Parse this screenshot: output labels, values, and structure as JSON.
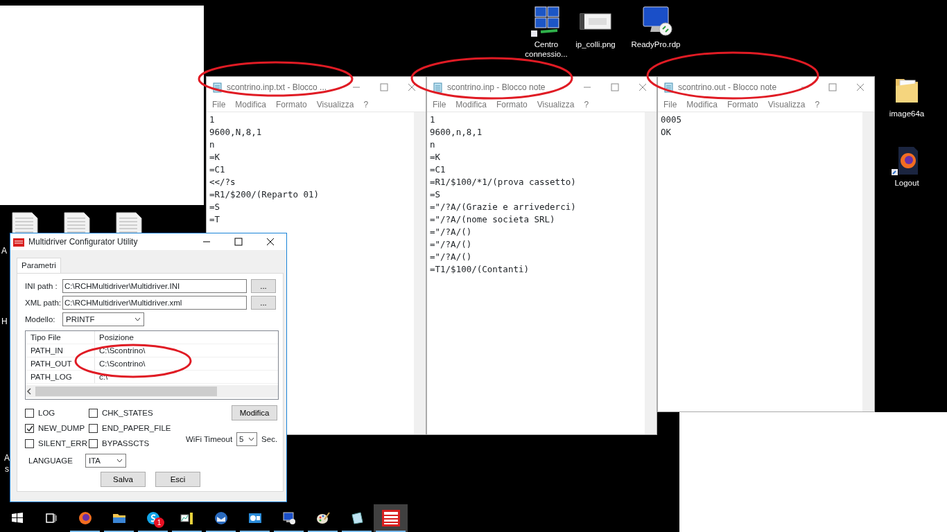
{
  "desktop_icons": [
    {
      "kind": "monitors",
      "label": "Centro connessio..."
    },
    {
      "kind": "image",
      "label": "ip_colli.png"
    },
    {
      "kind": "rdp",
      "label": "ReadyPro.rdp"
    },
    {
      "kind": "folder",
      "label": "image64a"
    },
    {
      "kind": "firefox",
      "label": "Logout"
    },
    {
      "kind": "document"
    },
    {
      "kind": "document"
    },
    {
      "kind": "document"
    }
  ],
  "label_fragments": [
    "A",
    "H",
    "A",
    "s"
  ],
  "notepads": [
    {
      "title": "scontrino.inp.txt - Blocco ...",
      "circled": true,
      "menu": [
        "File",
        "Modifica",
        "Formato",
        "Visualizza",
        "?"
      ],
      "lines": [
        "1",
        "9600,N,8,1",
        "n",
        "=K",
        "=C1",
        "<</?s",
        "=R1/$200/(Reparto 01)",
        "=S",
        "=T"
      ]
    },
    {
      "title": "scontrino.inp - Blocco note",
      "circled": true,
      "menu": [
        "File",
        "Modifica",
        "Formato",
        "Visualizza",
        "?"
      ],
      "lines": [
        "1",
        "9600,n,8,1",
        "n",
        "=K",
        "=C1",
        "=R1/$100/*1/(prova cassetto)",
        "=S",
        "=\"/?A/(Grazie e arrivederci)",
        "=\"/?A/(nome societa SRL)",
        "=\"/?A/()",
        "=\"/?A/()",
        "=\"/?A/()",
        "=T1/$100/(Contanti)"
      ]
    },
    {
      "title": "scontrino.out - Blocco note",
      "circled": true,
      "menu": [
        "File",
        "Modifica",
        "Formato",
        "Visualizza",
        "?"
      ],
      "lines": [
        "0005",
        "OK"
      ]
    }
  ],
  "dialog": {
    "title": "Multidriver Configurator Utility",
    "tabs": [
      {
        "label": "Parametri",
        "selected": true
      }
    ],
    "ini_path": {
      "label": "INI path :",
      "value": "C:\\RCHMultidriver\\Multidriver.INI",
      "button": "..."
    },
    "xml_path": {
      "label": "XML path:",
      "value": "C:\\RCHMultidriver\\Multidriver.xml",
      "button": "..."
    },
    "modello": {
      "label": "Modello:",
      "value": "PRINTF"
    },
    "file_table": {
      "columns": [
        "Tipo File",
        "Posizione"
      ],
      "circled": true,
      "rows": [
        {
          "tipo": "PATH_IN",
          "posizione": "C:\\Scontrino\\"
        },
        {
          "tipo": "PATH_OUT",
          "posizione": "C:\\Scontrino\\"
        },
        {
          "tipo": "PATH_LOG",
          "posizione": "c:\\"
        }
      ]
    },
    "options": [
      {
        "label": "LOG",
        "checked": false
      },
      {
        "label": "CHK_STATES",
        "checked": false
      },
      {
        "label": "NEW_DUMP",
        "checked": true
      },
      {
        "label": "END_PAPER_FILE",
        "checked": false
      },
      {
        "label": "SILENT_ERR",
        "checked": false
      },
      {
        "label": "BYPASSCTS",
        "checked": false
      }
    ],
    "modifica_button": "Modifica",
    "wifi_timeout": {
      "label": "WiFi Timeout",
      "value": "5",
      "unit": "Sec."
    },
    "language": {
      "label": "LANGUAGE",
      "value": "ITA"
    },
    "buttons": [
      "Salva",
      "Esci"
    ]
  },
  "taskbar": {
    "items": [
      {
        "kind": "windows",
        "running": false,
        "active": false
      },
      {
        "kind": "taskview",
        "running": false,
        "active": false
      },
      {
        "kind": "firefox",
        "running": true,
        "active": false
      },
      {
        "kind": "folder",
        "running": true,
        "active": false
      },
      {
        "kind": "skype",
        "running": true,
        "active": false,
        "badge": "1"
      },
      {
        "kind": "chart",
        "running": true,
        "active": false
      },
      {
        "kind": "mail",
        "running": true,
        "active": false
      },
      {
        "kind": "slides",
        "running": true,
        "active": false
      },
      {
        "kind": "rdp",
        "running": true,
        "active": false
      },
      {
        "kind": "paint",
        "running": true,
        "active": false
      },
      {
        "kind": "notepad",
        "running": true,
        "active": false
      },
      {
        "kind": "rch",
        "running": true,
        "active": true
      }
    ]
  }
}
